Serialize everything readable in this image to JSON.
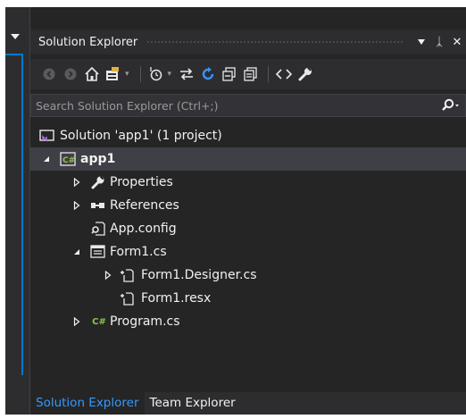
{
  "panel": {
    "title": "Solution Explorer",
    "pin_glyph": "ᛣ",
    "close_glyph": "✕"
  },
  "toolbar": {
    "buttons": [
      "back-icon",
      "forward-icon",
      "home-icon",
      "switch-views-icon",
      "pending-changes-icon",
      "sync-with-active-document-icon",
      "refresh-icon",
      "collapse-all-icon",
      "show-all-files-icon",
      "view-code-icon",
      "properties-icon"
    ]
  },
  "search": {
    "placeholder": "Search Solution Explorer (Ctrl+;)"
  },
  "tree": {
    "items": [
      {
        "label": "Solution 'app1' (1 project)",
        "icon": "solution-icon",
        "expanded": null,
        "selected": false
      },
      {
        "label": "app1",
        "icon": "csharp-project-icon",
        "expanded": true,
        "selected": true
      },
      {
        "label": "Properties",
        "icon": "wrench-icon",
        "expanded": false,
        "selected": false
      },
      {
        "label": "References",
        "icon": "references-icon",
        "expanded": false,
        "selected": false
      },
      {
        "label": "App.config",
        "icon": "config-file-icon",
        "expanded": null,
        "selected": false
      },
      {
        "label": "Form1.cs",
        "icon": "form-icon",
        "expanded": true,
        "selected": false
      },
      {
        "label": "Form1.Designer.cs",
        "icon": "designer-file-icon",
        "expanded": false,
        "selected": false
      },
      {
        "label": "Form1.resx",
        "icon": "resx-file-icon",
        "expanded": null,
        "selected": false
      },
      {
        "label": "Program.cs",
        "icon": "csharp-file-icon",
        "expanded": false,
        "selected": false
      }
    ],
    "csharp_badge": "C#"
  },
  "tabs": [
    {
      "label": "Solution Explorer",
      "active": true
    },
    {
      "label": "Team Explorer",
      "active": false
    }
  ],
  "colors": {
    "accent": "#007acc",
    "active_tab": "#3399ff",
    "csharp_green": "#8bc34a",
    "refresh_blue": "#3794ff"
  }
}
